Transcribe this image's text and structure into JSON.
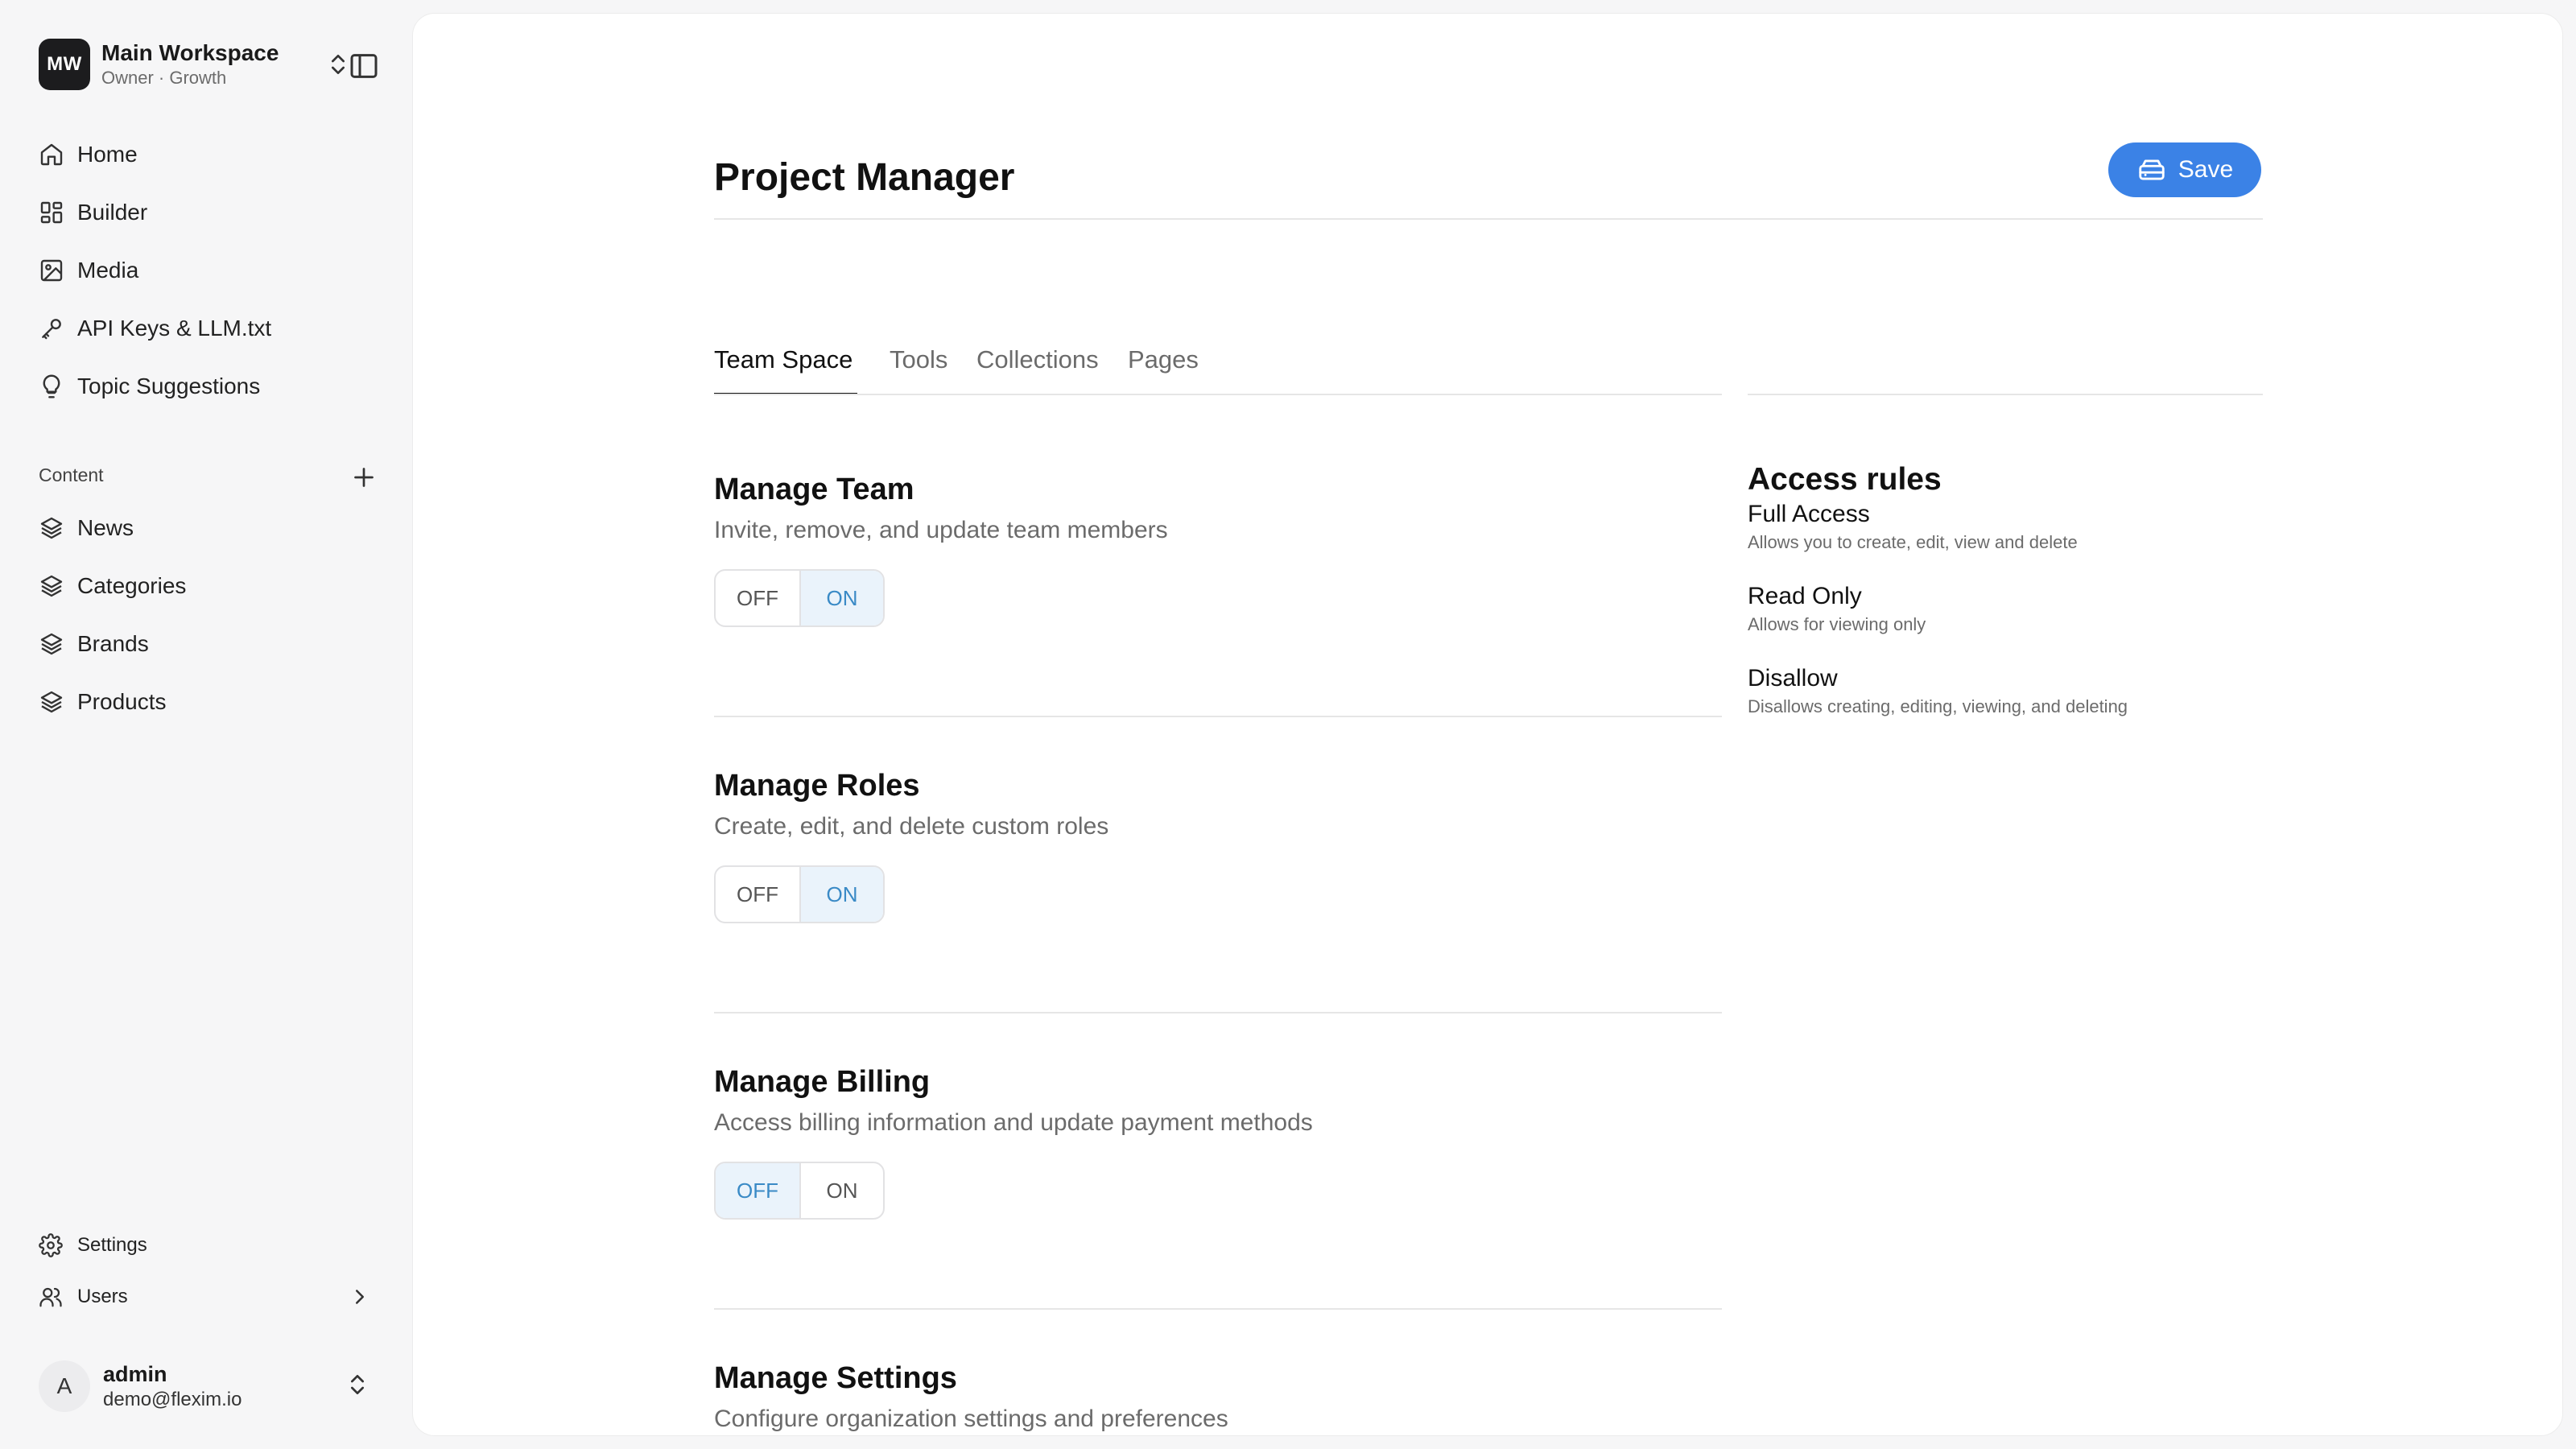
{
  "workspace": {
    "initials": "MW",
    "name": "Main Workspace",
    "subtitle": "Owner · Growth"
  },
  "nav": {
    "items": [
      {
        "label": "Home",
        "icon": "home-icon"
      },
      {
        "label": "Builder",
        "icon": "grid-icon"
      },
      {
        "label": "Media",
        "icon": "image-icon"
      },
      {
        "label": "API Keys & LLM.txt",
        "icon": "key-icon"
      },
      {
        "label": "Topic Suggestions",
        "icon": "lightbulb-icon"
      }
    ]
  },
  "content": {
    "label": "Content",
    "items": [
      {
        "label": "News",
        "icon": "layers-icon"
      },
      {
        "label": "Categories",
        "icon": "layers-icon"
      },
      {
        "label": "Brands",
        "icon": "layers-icon"
      },
      {
        "label": "Products",
        "icon": "layers-icon"
      }
    ]
  },
  "bottom": {
    "settings": "Settings",
    "users": "Users"
  },
  "user": {
    "initial": "A",
    "name": "admin",
    "email": "demo@flexim.io"
  },
  "page": {
    "title": "Project Manager",
    "save_label": "Save"
  },
  "tabs": [
    "Team Space",
    "Tools",
    "Collections",
    "Pages"
  ],
  "active_tab": "Team Space",
  "toggle_labels": {
    "off": "OFF",
    "on": "ON"
  },
  "permissions": [
    {
      "title": "Manage Team",
      "description": "Invite, remove, and update team members",
      "value": "ON"
    },
    {
      "title": "Manage Roles",
      "description": "Create, edit, and delete custom roles",
      "value": "ON"
    },
    {
      "title": "Manage Billing",
      "description": "Access billing information and update payment methods",
      "value": "OFF"
    },
    {
      "title": "Manage Settings",
      "description": "Configure organization settings and preferences",
      "value": ""
    }
  ],
  "access_rules": {
    "title": "Access rules",
    "rules": [
      {
        "name": "Full Access",
        "description": "Allows you to create, edit, view and delete"
      },
      {
        "name": "Read Only",
        "description": "Allows for viewing only"
      },
      {
        "name": "Disallow",
        "description": "Disallows creating, editing, viewing, and deleting"
      }
    ]
  },
  "colors": {
    "accent": "#3b82e6",
    "toggle_selected_bg": "#eaf3fb",
    "toggle_selected_text": "#3a8ac6"
  }
}
